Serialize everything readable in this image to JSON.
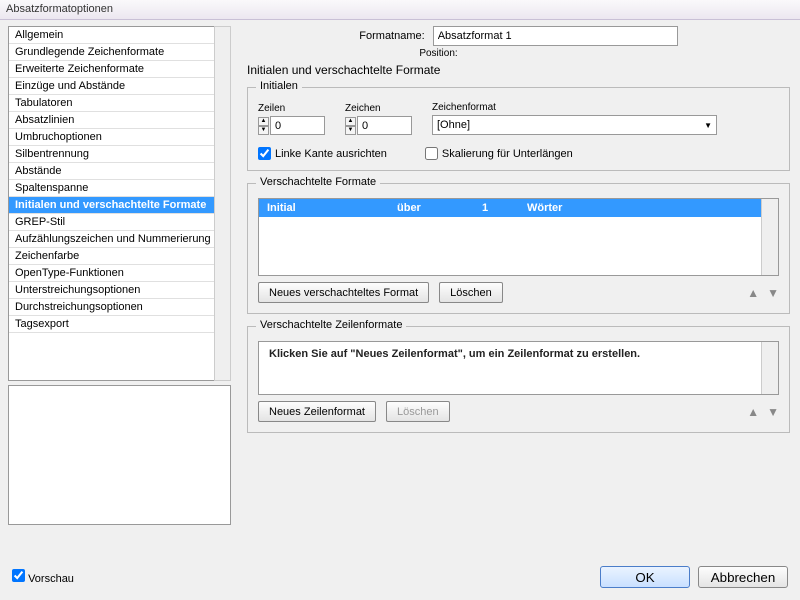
{
  "window": {
    "title": "Absatzformatoptionen"
  },
  "sidebar": {
    "items": [
      {
        "label": "Allgemein"
      },
      {
        "label": "Grundlegende Zeichenformate"
      },
      {
        "label": "Erweiterte Zeichenformate"
      },
      {
        "label": "Einzüge und Abstände"
      },
      {
        "label": "Tabulatoren"
      },
      {
        "label": "Absatzlinien"
      },
      {
        "label": "Umbruchoptionen"
      },
      {
        "label": "Silbentrennung"
      },
      {
        "label": "Abstände"
      },
      {
        "label": "Spaltenspanne"
      },
      {
        "label": "Initialen und verschachtelte Formate",
        "selected": true
      },
      {
        "label": "GREP-Stil"
      },
      {
        "label": "Aufzählungszeichen und Nummerierung"
      },
      {
        "label": "Zeichenfarbe"
      },
      {
        "label": "OpenType-Funktionen"
      },
      {
        "label": "Unterstreichungsoptionen"
      },
      {
        "label": "Durchstreichungsoptionen"
      },
      {
        "label": "Tagsexport"
      }
    ]
  },
  "header": {
    "name_label": "Formatname:",
    "name_value": "Absatzformat 1",
    "position_label": "Position:",
    "section_title": "Initialen und verschachtelte Formate"
  },
  "initialen": {
    "legend": "Initialen",
    "zeilen_label": "Zeilen",
    "zeilen_value": "0",
    "zeichen_label": "Zeichen",
    "zeichen_value": "0",
    "zeichenformat_label": "Zeichenformat",
    "zeichenformat_value": "[Ohne]",
    "linke_kante_label": "Linke Kante ausrichten",
    "linke_kante_checked": true,
    "skalierung_label": "Skalierung für Unterlängen",
    "skalierung_checked": false
  },
  "nested": {
    "legend": "Verschachtelte Formate",
    "row": {
      "c1": "Initial",
      "c2": "über",
      "c3": "1",
      "c4": "Wörter"
    },
    "new_label": "Neues verschachteltes Format",
    "delete_label": "Löschen"
  },
  "nested_lines": {
    "legend": "Verschachtelte Zeilenformate",
    "hint": "Klicken Sie auf \"Neues Zeilenformat\", um ein Zeilenformat zu erstellen.",
    "new_label": "Neues Zeilenformat",
    "delete_label": "Löschen"
  },
  "footer": {
    "vorschau_label": "Vorschau",
    "vorschau_checked": true,
    "ok": "OK",
    "cancel": "Abbrechen"
  }
}
